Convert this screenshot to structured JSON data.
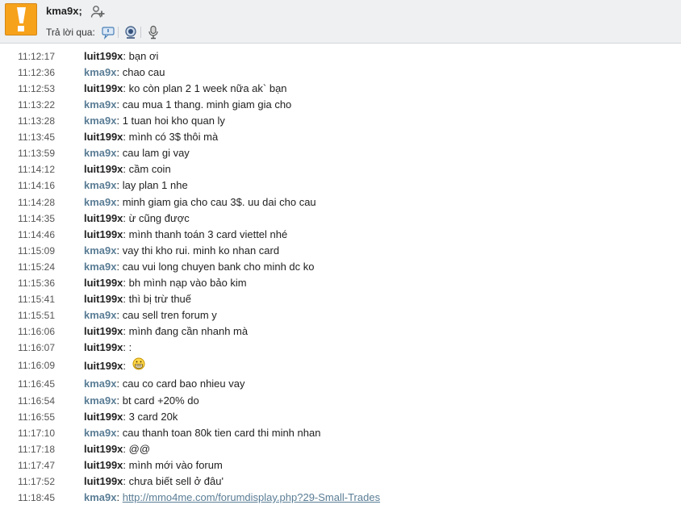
{
  "header": {
    "username": "kma9x;",
    "reply_via_label": "Trả lời qua:"
  },
  "messages": [
    {
      "time": "11:12:17",
      "sender": "luit199x",
      "self": false,
      "text": "bạn ơi"
    },
    {
      "time": "11:12:36",
      "sender": "kma9x",
      "self": true,
      "text": "chao cau"
    },
    {
      "time": "11:12:53",
      "sender": "luit199x",
      "self": false,
      "text": "ko còn plan 2 1 week nữa ak` bạn"
    },
    {
      "time": "11:13:22",
      "sender": "kma9x",
      "self": true,
      "text": "cau mua 1 thang. minh giam gia cho"
    },
    {
      "time": "11:13:28",
      "sender": "kma9x",
      "self": true,
      "text": "1 tuan hoi kho quan ly"
    },
    {
      "time": "11:13:45",
      "sender": "luit199x",
      "self": false,
      "text": "mình có 3$ thôi mà"
    },
    {
      "time": "11:13:59",
      "sender": "kma9x",
      "self": true,
      "text": "cau lam gi vay"
    },
    {
      "time": "11:14:12",
      "sender": "luit199x",
      "self": false,
      "text": "cầm coin"
    },
    {
      "time": "11:14:16",
      "sender": "kma9x",
      "self": true,
      "text": "lay plan 1 nhe"
    },
    {
      "time": "11:14:28",
      "sender": "kma9x",
      "self": true,
      "text": "minh giam gia cho cau 3$. uu dai cho cau"
    },
    {
      "time": "11:14:35",
      "sender": "luit199x",
      "self": false,
      "text": "ừ cũng được"
    },
    {
      "time": "11:14:46",
      "sender": "luit199x",
      "self": false,
      "text": "mình thanh toán 3 card viettel nhé"
    },
    {
      "time": "11:15:09",
      "sender": "kma9x",
      "self": true,
      "text": "vay thi kho rui. minh ko nhan card"
    },
    {
      "time": "11:15:24",
      "sender": "kma9x",
      "self": true,
      "text": "cau vui long chuyen bank cho minh dc ko"
    },
    {
      "time": "11:15:36",
      "sender": "luit199x",
      "self": false,
      "text": "bh mình nạp vào bảo kim"
    },
    {
      "time": "11:15:41",
      "sender": "luit199x",
      "self": false,
      "text": "thì bị trừ thuế"
    },
    {
      "time": "11:15:51",
      "sender": "kma9x",
      "self": true,
      "text": "cau sell tren forum y"
    },
    {
      "time": "11:16:06",
      "sender": "luit199x",
      "self": false,
      "text": "mình đang cần nhanh mà"
    },
    {
      "time": "11:16:07",
      "sender": "luit199x",
      "self": false,
      "text": ":"
    },
    {
      "time": "11:16:09",
      "sender": "luit199x",
      "self": false,
      "text": "",
      "emoticon": "grin-emoticon-icon"
    },
    {
      "time": "11:16:45",
      "sender": "kma9x",
      "self": true,
      "text": "cau co card bao nhieu vay"
    },
    {
      "time": "11:16:54",
      "sender": "kma9x",
      "self": true,
      "text": "bt card +20% do"
    },
    {
      "time": "11:16:55",
      "sender": "luit199x",
      "self": false,
      "text": "3 card 20k"
    },
    {
      "time": "11:17:10",
      "sender": "kma9x",
      "self": true,
      "text": "cau thanh toan 80k tien card thi minh nhan"
    },
    {
      "time": "11:17:18",
      "sender": "luit199x",
      "self": false,
      "text": "@@"
    },
    {
      "time": "11:17:47",
      "sender": "luit199x",
      "self": false,
      "text": "mình mới vào forum"
    },
    {
      "time": "11:17:52",
      "sender": "luit199x",
      "self": false,
      "text": "chưa biết sell ở đâu'"
    },
    {
      "time": "11:18:45",
      "sender": "kma9x",
      "self": true,
      "text": "",
      "link": "http://mmo4me.com/forumdisplay.php?29-Small-Trades"
    }
  ],
  "colors": {
    "self_sender": "#5a7d95",
    "other_sender": "#222222",
    "avatar": "#f7a21b",
    "header_bg": "#eef0f2"
  }
}
